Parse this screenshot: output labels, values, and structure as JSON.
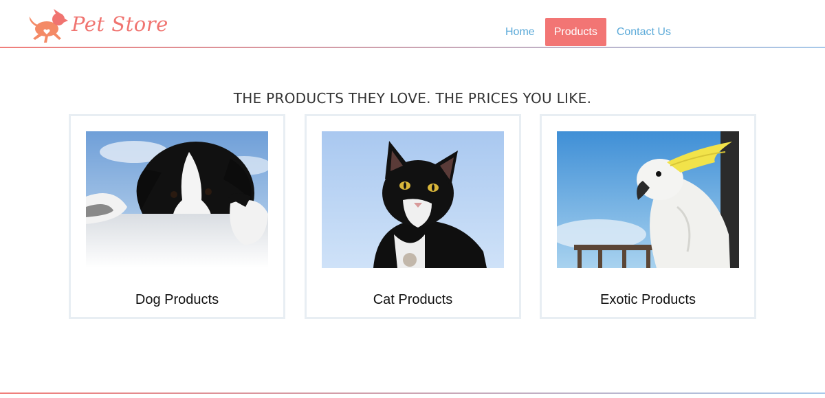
{
  "brand": {
    "name": "Pet Store",
    "logo_icon": "running-dog-icon",
    "accent_color": "#f27574"
  },
  "nav": {
    "items": [
      {
        "label": "Home",
        "active": false
      },
      {
        "label": "Products",
        "active": true
      },
      {
        "label": "Contact Us",
        "active": false
      }
    ],
    "link_color": "#5aa9d8"
  },
  "main": {
    "tagline": "THE PRODUCTS THEY LOVE. THE PRICES YOU LIKE.",
    "cards": [
      {
        "label": "Dog Products",
        "image": "puppy-photo"
      },
      {
        "label": "Cat Products",
        "image": "cat-photo"
      },
      {
        "label": "Exotic Products",
        "image": "cockatoo-photo"
      }
    ]
  }
}
